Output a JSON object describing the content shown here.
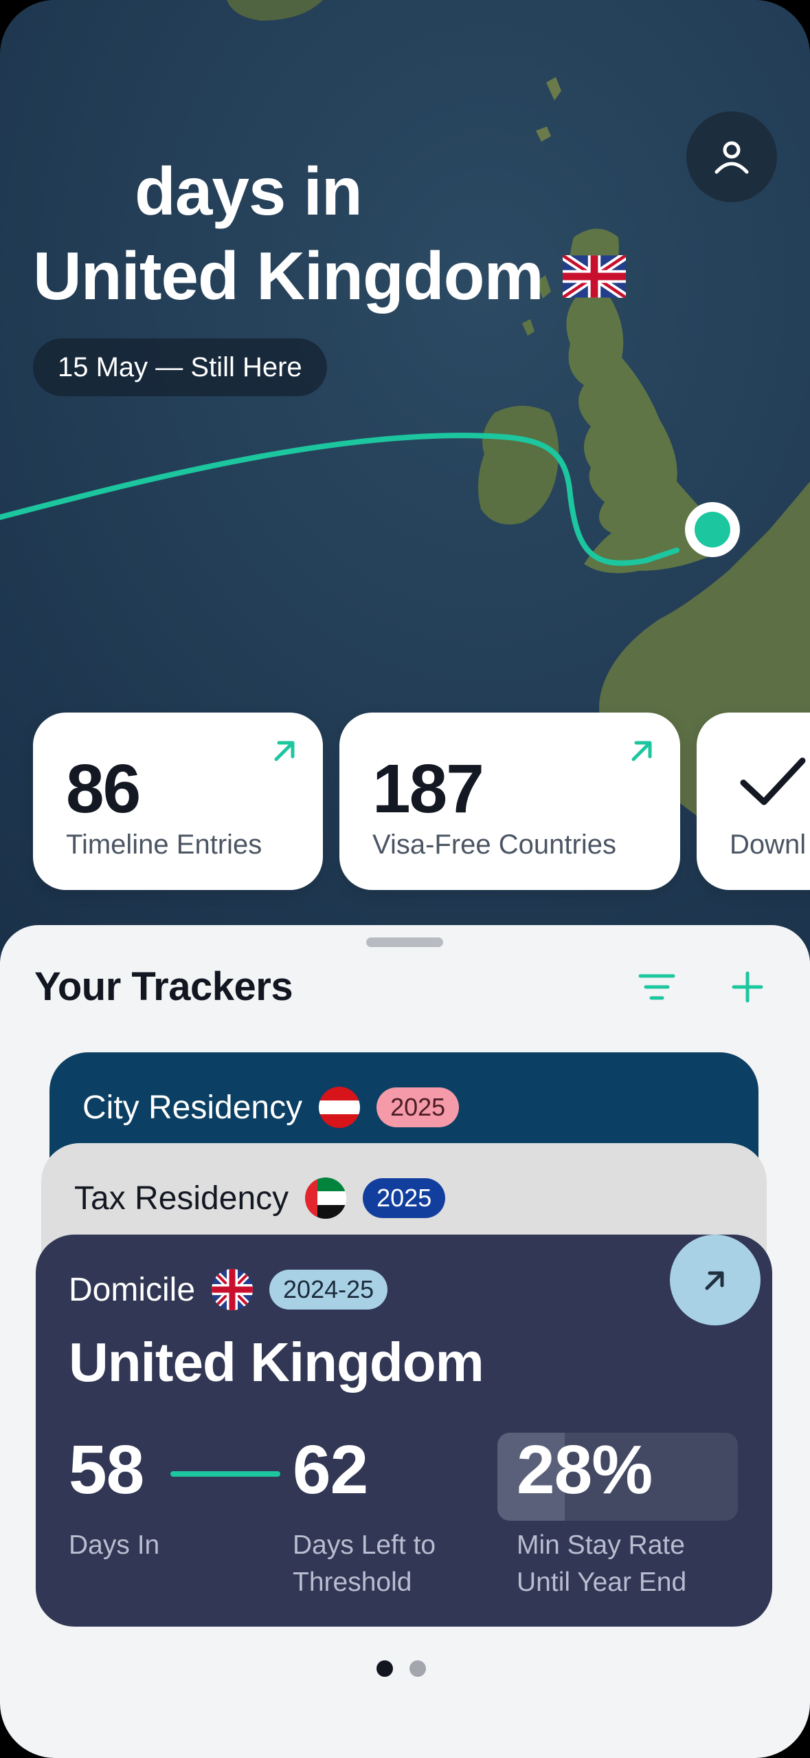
{
  "hero": {
    "days_label": "days in",
    "country": "United Kingdom",
    "date_range": "15 May — Still Here"
  },
  "stats": [
    {
      "value": "86",
      "label": "Timeline Entries"
    },
    {
      "value": "187",
      "label": "Visa-Free Countries"
    },
    {
      "label": "Downl"
    }
  ],
  "sheet": {
    "title": "Your Trackers"
  },
  "trackers": {
    "city": {
      "label": "City Residency",
      "year": "2025"
    },
    "tax": {
      "label": "Tax Residency",
      "year": "2025"
    },
    "domicile": {
      "label": "Domicile",
      "year": "2024-25",
      "country": "United Kingdom",
      "days_in": "58",
      "days_in_label": "Days In",
      "days_left": "62",
      "days_left_label_1": "Days Left to",
      "days_left_label_2": "Threshold",
      "rate": "28%",
      "rate_fraction": 0.28,
      "rate_label_1": "Min Stay Rate",
      "rate_label_2": "Until Year End"
    }
  },
  "pagination": {
    "count": 2,
    "active": 0
  },
  "colors": {
    "accent": "#1cc69f",
    "card_dark": "#313754",
    "city_card": "#0b3f63",
    "city_badge": "#f59aa8",
    "tax_badge": "#123f9e",
    "domicile_badge": "#a9d1e6"
  }
}
